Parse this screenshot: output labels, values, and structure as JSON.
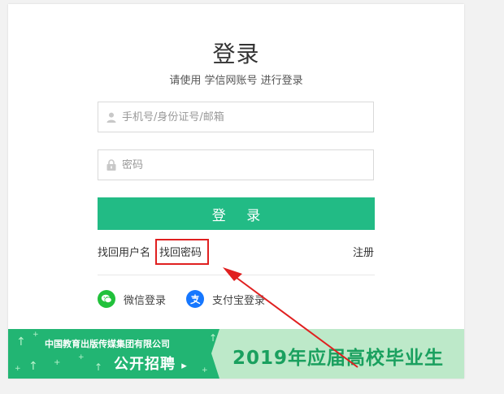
{
  "login": {
    "title": "登录",
    "subtitle": "请使用 学信网账号 进行登录",
    "account_placeholder": "手机号/身份证号/邮箱",
    "password_placeholder": "密码",
    "login_button": "登 录"
  },
  "links": {
    "find_username": "找回用户名",
    "find_password": "找回密码",
    "register": "注册"
  },
  "social": {
    "wechat": "微信登录",
    "alipay": "支付宝登录"
  },
  "banner": {
    "company": "中国教育出版传媒集团有限公司",
    "recruit": "公开招聘",
    "recruit_arrow": "▸",
    "graduates": "2019年应届高校毕业生"
  },
  "annotation": {
    "color": "#e02020"
  },
  "colors": {
    "primary": "#22bb85",
    "banner_green": "#22b573",
    "banner_light": "#bde9c9",
    "wechat": "#21c13b",
    "alipay": "#1677ff"
  }
}
